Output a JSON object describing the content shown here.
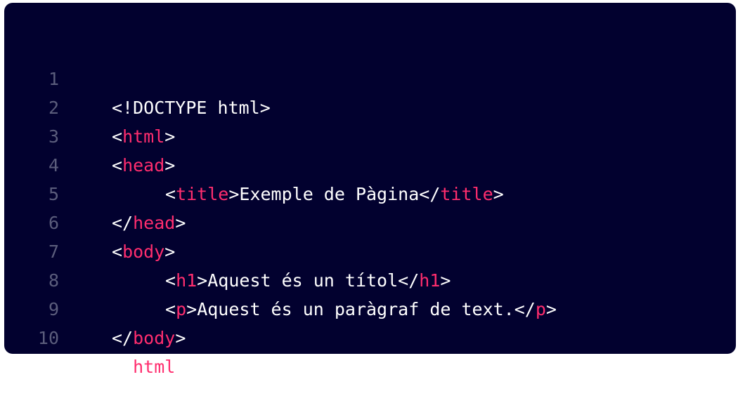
{
  "colors": {
    "background": "#02012f",
    "tag": "#ff2d6e",
    "text": "#ffffff",
    "line_number": "#5b5d7c"
  },
  "code": {
    "lines": [
      {
        "number": "1",
        "doctype": "<!DOCTYPE html>"
      },
      {
        "number": "2",
        "tag": "html"
      },
      {
        "number": "3",
        "tag": "head"
      },
      {
        "number": "4",
        "tag": "title",
        "text": "Exemple de Pàgina"
      },
      {
        "number": "5",
        "tag": "head"
      },
      {
        "number": "6",
        "tag": "body"
      },
      {
        "number": "7",
        "tag": "h1",
        "text": "Aquest és un títol"
      },
      {
        "number": "8",
        "tag": "p",
        "text": "Aquest és un paràgraf de text."
      },
      {
        "number": "9",
        "tag": "body"
      },
      {
        "number": "10",
        "tag": "html"
      }
    ]
  }
}
